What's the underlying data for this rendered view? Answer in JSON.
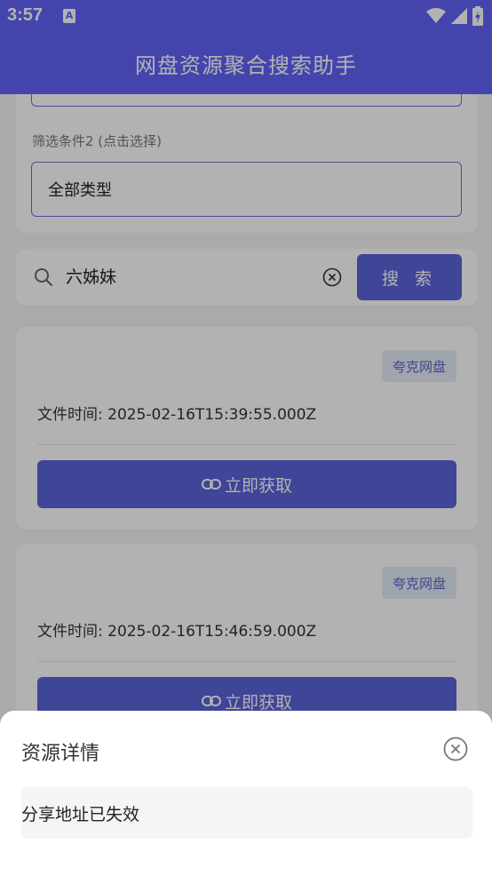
{
  "status_bar": {
    "time": "3:57",
    "notification_icon": "A"
  },
  "app_bar": {
    "title": "网盘资源聚合搜索助手"
  },
  "filters": {
    "label": "筛选条件2 (点击选择)",
    "selected": "全部类型"
  },
  "search": {
    "query": "六姊妹",
    "button_label": "搜 索"
  },
  "results": [
    {
      "tag": "夸克网盘",
      "time_text": "文件时间: 2025-02-16T15:39:55.000Z",
      "button_label": "立即获取"
    },
    {
      "tag": "夸克网盘",
      "time_text": "文件时间: 2025-02-16T15:46:59.000Z",
      "button_label": "立即获取"
    }
  ],
  "sheet": {
    "title": "资源详情",
    "message": "分享地址已失效"
  },
  "colors": {
    "primary": "#6164f7",
    "button": "#5b64d9",
    "tag_bg": "#e6ebf7"
  }
}
